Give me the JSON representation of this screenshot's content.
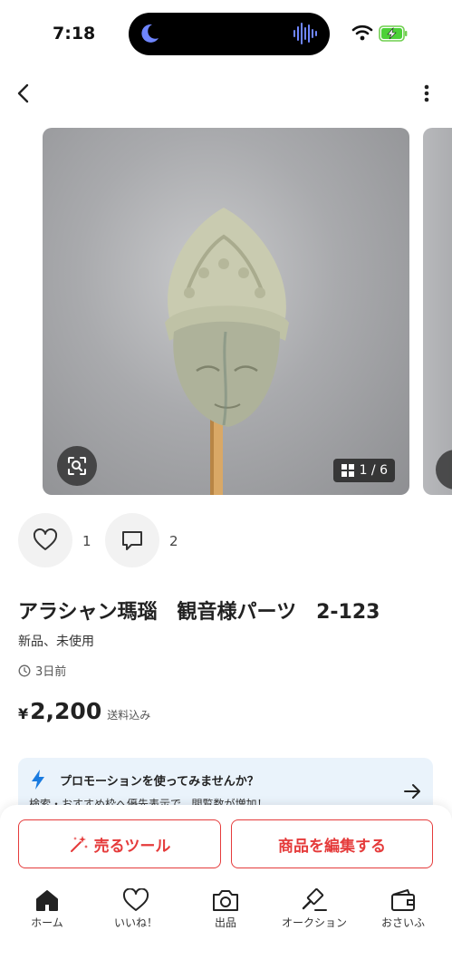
{
  "status_bar": {
    "time": "7:18"
  },
  "gallery": {
    "counter": "1 / 6"
  },
  "reactions": {
    "likes": "1",
    "comments": "2"
  },
  "product": {
    "title": "アラシャン瑪瑙　観音様パーツ　2-123",
    "condition": "新品、未使用",
    "posted": "3日前",
    "price_symbol": "¥",
    "price": "2,200",
    "price_note": "送料込み"
  },
  "promo": {
    "title": "プロモーションを使ってみませんか？",
    "subtitle": "検索・おすすめ枠へ優先表示で、閲覧数が増加！"
  },
  "actions": {
    "sell_tool": "売るツール",
    "edit_item": "商品を編集する"
  },
  "tabs": [
    {
      "label": "ホーム",
      "icon": "home-icon"
    },
    {
      "label": "いいね！",
      "icon": "heart-icon"
    },
    {
      "label": "出品",
      "icon": "camera-icon"
    },
    {
      "label": "オークション",
      "icon": "gavel-icon"
    },
    {
      "label": "おさいふ",
      "icon": "wallet-icon"
    }
  ],
  "colors": {
    "accent": "#e53b3b",
    "promo_bg": "#eaf3fb",
    "bolt": "#1a7be0"
  }
}
